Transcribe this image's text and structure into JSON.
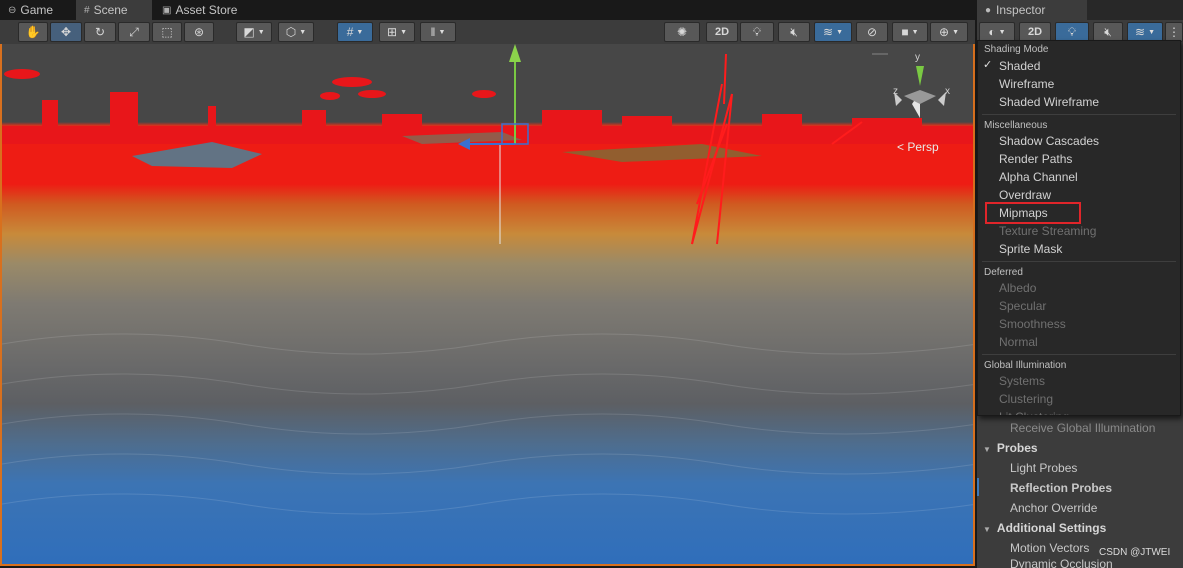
{
  "tabs": {
    "game": "Game",
    "scene": "Scene",
    "asset_store": "Asset Store",
    "inspector": "Inspector"
  },
  "toolbar": {
    "two_d": "2D",
    "inspector_two_d": "2D"
  },
  "scene": {
    "persp_label": "Persp",
    "gizmo_y": "y",
    "gizmo_z": "z",
    "gizmo_x": "x"
  },
  "menu": {
    "shading_mode_header": "Shading Mode",
    "shading_items": [
      {
        "label": "Shaded",
        "checked": true
      },
      {
        "label": "Wireframe"
      },
      {
        "label": "Shaded Wireframe"
      }
    ],
    "misc_header": "Miscellaneous",
    "misc_items": [
      {
        "label": "Shadow Cascades"
      },
      {
        "label": "Render Paths"
      },
      {
        "label": "Alpha Channel"
      },
      {
        "label": "Overdraw"
      },
      {
        "label": "Mipmaps",
        "highlighted": true
      },
      {
        "label": "Texture Streaming",
        "disabled": true
      },
      {
        "label": "Sprite Mask"
      }
    ],
    "deferred_header": "Deferred",
    "deferred_items": [
      {
        "label": "Albedo",
        "disabled": true
      },
      {
        "label": "Specular",
        "disabled": true
      },
      {
        "label": "Smoothness",
        "disabled": true
      },
      {
        "label": "Normal",
        "disabled": true
      }
    ],
    "gi_header": "Global Illumination",
    "gi_items": [
      {
        "label": "Systems",
        "disabled": true
      },
      {
        "label": "Clustering",
        "disabled": true
      },
      {
        "label": "Lit Clustering",
        "disabled": true
      }
    ],
    "checkmark": "✓"
  },
  "inspector": {
    "receive_gi": "Receive Global Illumination",
    "probes_header": "Probes",
    "light_probes": "Light Probes",
    "reflection_probes": "Reflection Probes",
    "anchor_override": "Anchor Override",
    "additional_header": "Additional Settings",
    "motion_vectors": "Motion Vectors",
    "dynamic_occlusion": "Dynamic Occlusion"
  },
  "watermark": "CSDN @JTWEI",
  "colors": {
    "accent_blue": "#3a79bb",
    "highlight_red": "#e0252a",
    "scene_border": "#d8701e"
  }
}
